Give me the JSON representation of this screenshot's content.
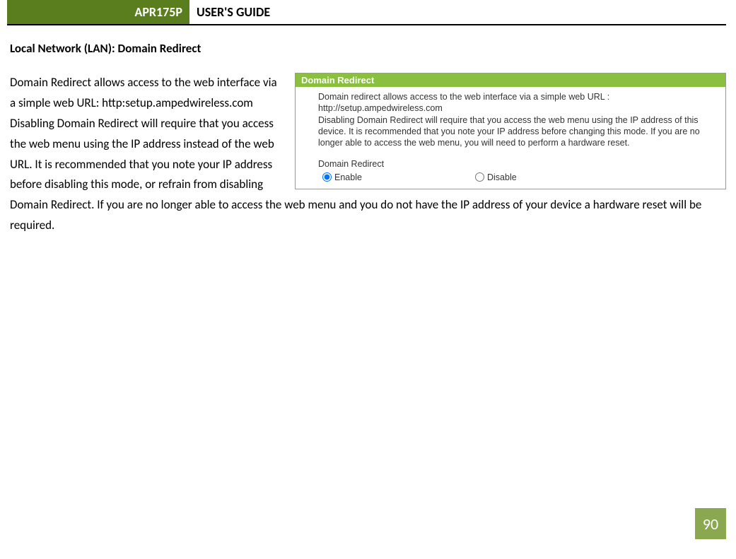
{
  "header": {
    "model": "APR175P",
    "title": "USER'S GUIDE"
  },
  "section": {
    "heading": "Local Network (LAN): Domain Redirect"
  },
  "body": {
    "paragraph": "Domain Redirect allows access to the web interface via a simple web URL: http:setup.ampedwireless.com Disabling Domain Redirect will require that you access the web menu using the IP address instead of the web URL.  It is recommended that you note your IP address before disabling this mode, or refrain from disabling Domain Redirect.  If you are no longer able to access the web menu and you do not have the IP address of your device a hardware reset will be required."
  },
  "panel": {
    "header": "Domain Redirect",
    "desc_line1": "Domain redirect allows access to the web interface via a simple web URL :",
    "desc_line2": "http://setup.ampedwireless.com",
    "desc_line3": "Disabling Domain Redirect will require that you access the web menu using the IP address of this device. It is recommended that you note your IP address before changing this mode. If you are no longer able to access the web menu, you will need to perform a hardware reset.",
    "section_label": "Domain Redirect",
    "option_enable": "Enable",
    "option_disable": "Disable"
  },
  "page_number": "90"
}
